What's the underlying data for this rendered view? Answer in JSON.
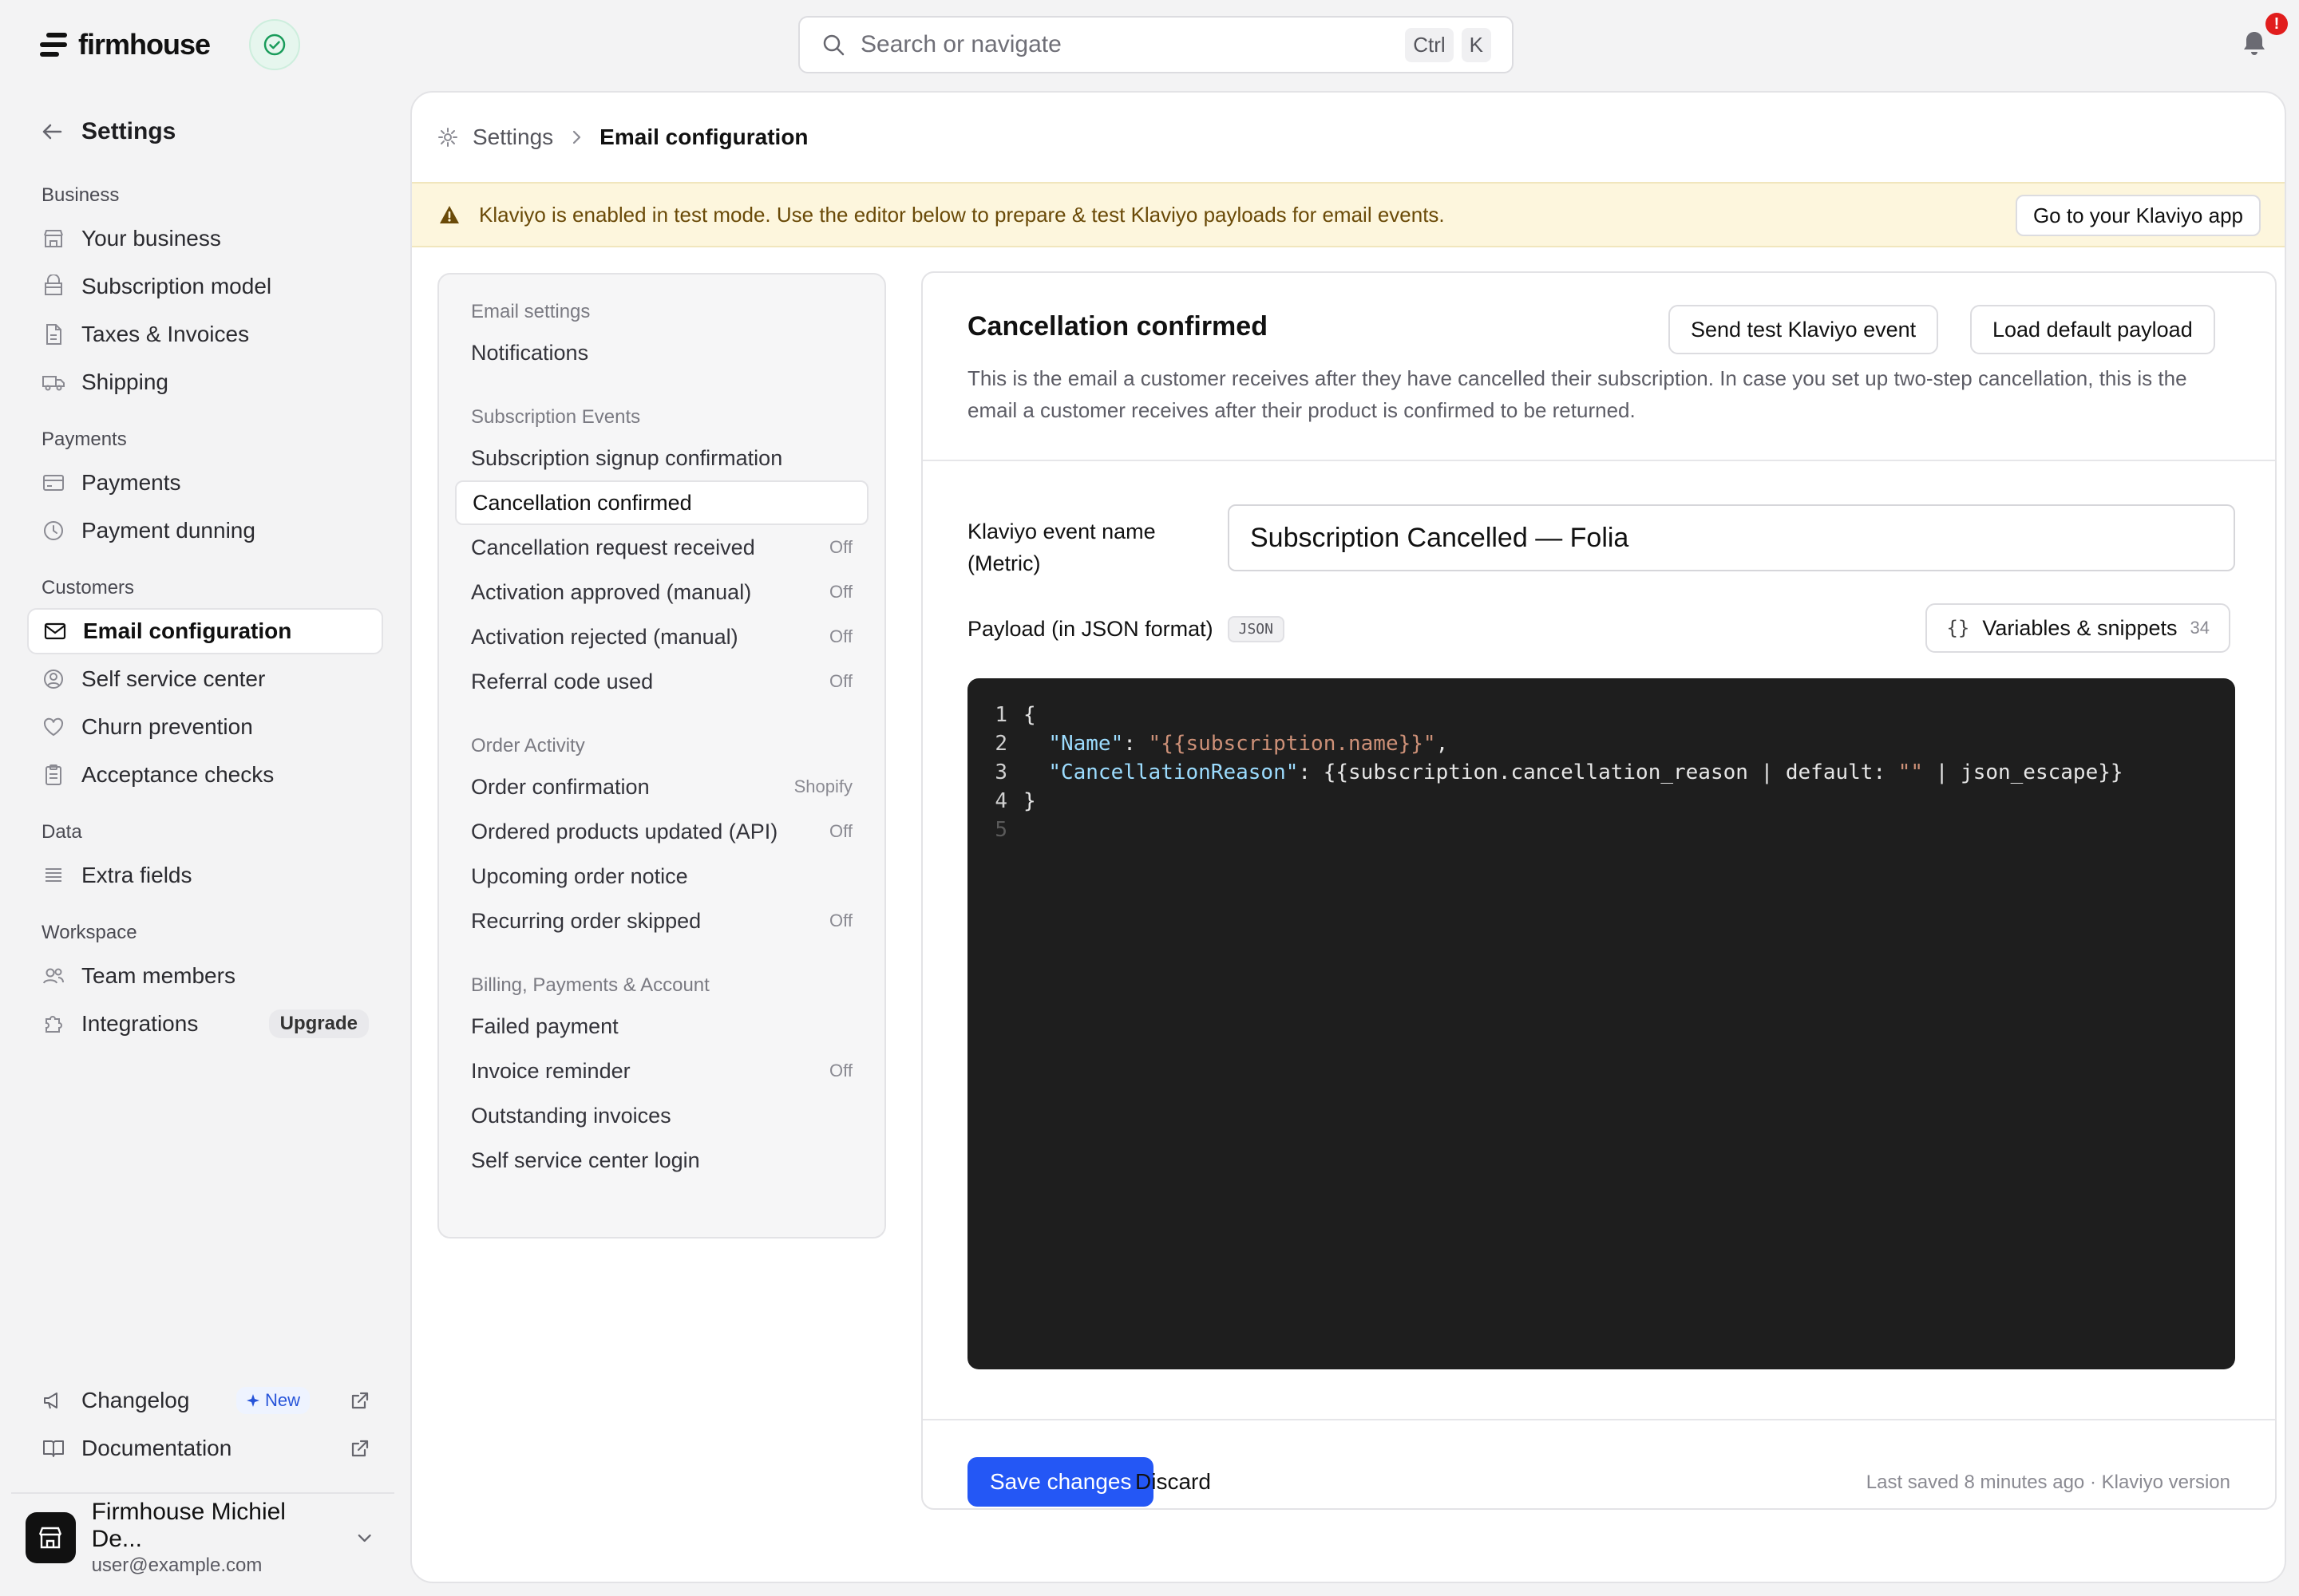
{
  "app": {
    "brand": "firmhouse",
    "search_placeholder": "Search or navigate",
    "search_shortcut": [
      "Ctrl",
      "K"
    ],
    "notification_badge": "!"
  },
  "sidebar": {
    "title": "Settings",
    "groups": [
      {
        "label": "Business",
        "items": [
          {
            "label": "Your business",
            "icon": "store-icon"
          },
          {
            "label": "Subscription model",
            "icon": "box-icon"
          },
          {
            "label": "Taxes & Invoices",
            "icon": "document-icon"
          },
          {
            "label": "Shipping",
            "icon": "truck-icon"
          }
        ]
      },
      {
        "label": "Payments",
        "items": [
          {
            "label": "Payments",
            "icon": "credit-card-icon"
          },
          {
            "label": "Payment dunning",
            "icon": "clock-icon"
          }
        ]
      },
      {
        "label": "Customers",
        "items": [
          {
            "label": "Email configuration",
            "icon": "mail-icon",
            "active": true
          },
          {
            "label": "Self service center",
            "icon": "user-circle-icon"
          },
          {
            "label": "Churn prevention",
            "icon": "heart-icon"
          },
          {
            "label": "Acceptance checks",
            "icon": "clipboard-icon"
          }
        ]
      },
      {
        "label": "Data",
        "items": [
          {
            "label": "Extra fields",
            "icon": "list-icon"
          }
        ]
      },
      {
        "label": "Workspace",
        "items": [
          {
            "label": "Team members",
            "icon": "users-icon"
          },
          {
            "label": "Integrations",
            "icon": "puzzle-icon",
            "badge": "Upgrade"
          }
        ]
      }
    ],
    "bottom": {
      "changelog": "Changelog",
      "changelog_badge": "New",
      "documentation": "Documentation"
    },
    "account": {
      "name": "Firmhouse Michiel De...",
      "email": "user@example.com"
    }
  },
  "breadcrumb": [
    "Settings",
    "Email configuration"
  ],
  "banner": {
    "text": "Klaviyo is enabled in test mode. Use the editor below to prepare & test Klaviyo payloads for email events.",
    "button": "Go to your Klaviyo app"
  },
  "events": {
    "groups": [
      {
        "label": "Email settings",
        "items": [
          {
            "label": "Notifications",
            "tag": ""
          }
        ]
      },
      {
        "label": "Subscription Events",
        "items": [
          {
            "label": "Subscription signup confirmation",
            "tag": ""
          },
          {
            "label": "Cancellation confirmed",
            "tag": "",
            "active": true
          },
          {
            "label": "Cancellation request received",
            "tag": "Off"
          },
          {
            "label": "Activation approved (manual)",
            "tag": "Off"
          },
          {
            "label": "Activation rejected (manual)",
            "tag": "Off"
          },
          {
            "label": "Referral code used",
            "tag": "Off"
          }
        ]
      },
      {
        "label": "Order Activity",
        "items": [
          {
            "label": "Order confirmation",
            "tag": "Shopify"
          },
          {
            "label": "Ordered products updated (API)",
            "tag": "Off"
          },
          {
            "label": "Upcoming order notice",
            "tag": ""
          },
          {
            "label": "Recurring order skipped",
            "tag": "Off"
          }
        ]
      },
      {
        "label": "Billing, Payments & Account",
        "items": [
          {
            "label": "Failed payment",
            "tag": ""
          },
          {
            "label": "Invoice reminder",
            "tag": "Off"
          },
          {
            "label": "Outstanding invoices",
            "tag": ""
          },
          {
            "label": "Self service center login",
            "tag": ""
          }
        ]
      }
    ]
  },
  "editor": {
    "title": "Cancellation confirmed",
    "send_test_button": "Send test Klaviyo event",
    "load_default_button": "Load default payload",
    "description": "This is the email a customer receives after they have cancelled their subscription. In case you set up two-step cancellation, this is the email a customer receives after their product is confirmed to be returned.",
    "event_name_label": "Klaviyo event name (Metric)",
    "event_name_value": "Subscription Cancelled — Folia",
    "payload_label": "Payload (in JSON format)",
    "payload_badge": "JSON",
    "snippets_button": "Variables & snippets",
    "snippets_count": "34",
    "code": {
      "line_numbers": [
        "1",
        "2",
        "3",
        "4",
        "5"
      ],
      "open_brace": "{",
      "close_brace": "}",
      "key1": "\"Name\"",
      "val1": "\"{{subscription.name}}\"",
      "key2": "\"CancellationReason\"",
      "val2_part1": "{{subscription.cancellation_reason | default: ",
      "val2_str": "\"\"",
      "val2_part2": " | json_escape}}"
    },
    "save_button": "Save changes",
    "discard_button": "Discard",
    "last_saved": "Last saved 8 minutes ago · Klaviyo version"
  }
}
